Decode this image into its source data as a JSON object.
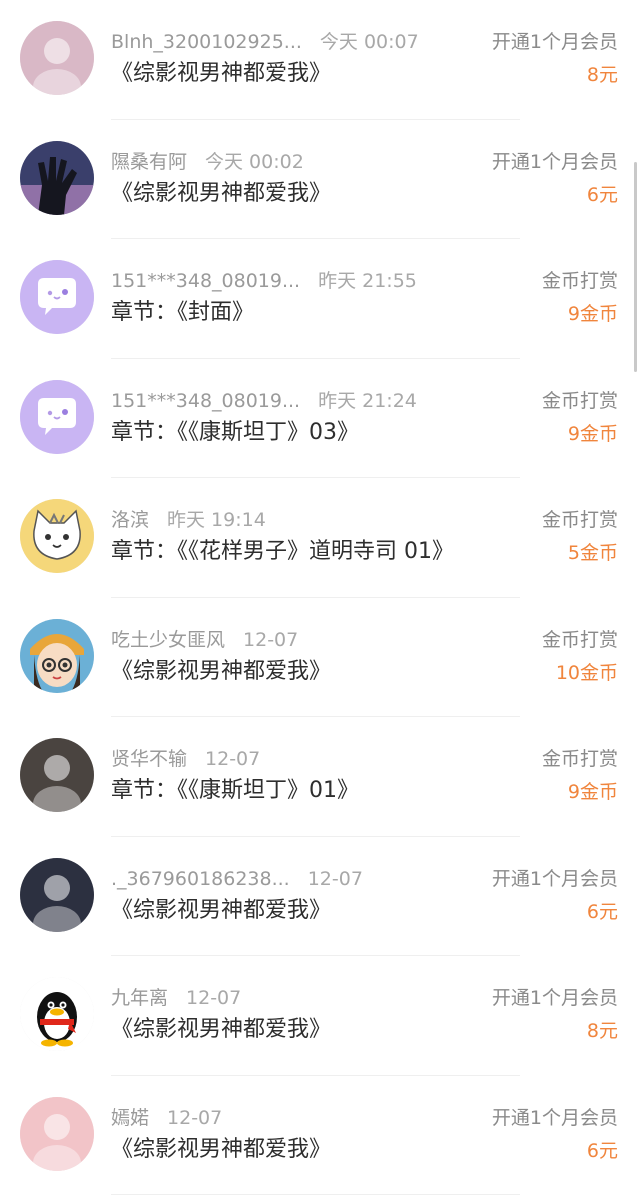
{
  "rows": [
    {
      "name": "Blnh_3200102925...",
      "time": "今天 00:07",
      "title": "《综影视男神都爱我》",
      "type": "开通1个月会员",
      "amount": "8元",
      "avatar": "photo-icon",
      "avatar_color": "#d9b8c6"
    },
    {
      "name": "隰桑有阿",
      "time": "今天 00:02",
      "title": "《综影视男神都爱我》",
      "type": "开通1个月会员",
      "amount": "6元",
      "avatar": "hand-silhouette-icon",
      "avatar_color": "#3a3f6b"
    },
    {
      "name": "151***348_08019...",
      "time": "昨天 21:55",
      "title": "章节：《封面》",
      "type": "金币打赏",
      "amount": "9金币",
      "avatar": "chat-bubble-icon",
      "avatar_color": "#c9b5f3"
    },
    {
      "name": "151***348_08019...",
      "time": "昨天 21:24",
      "title": "章节：《《康斯坦丁》03》",
      "type": "金币打赏",
      "amount": "9金币",
      "avatar": "chat-bubble-icon",
      "avatar_color": "#c9b5f3"
    },
    {
      "name": "洛滨",
      "time": "昨天 19:14",
      "title": "章节：《《花样男子》道明寺司 01》",
      "type": "金币打赏",
      "amount": "5金币",
      "avatar": "cat-icon",
      "avatar_color": "#f5d77a"
    },
    {
      "name": "吃土少女匪风",
      "time": "12-07",
      "title": "《综影视男神都爱我》",
      "type": "金币打赏",
      "amount": "10金币",
      "avatar": "cartoon-girl-icon",
      "avatar_color": "#e8a63a"
    },
    {
      "name": "贤华不输",
      "time": "12-07",
      "title": "章节：《《康斯坦丁》01》",
      "type": "金币打赏",
      "amount": "9金币",
      "avatar": "photo-icon",
      "avatar_color": "#4a4440"
    },
    {
      "name": "._367960186238...",
      "time": "12-07",
      "title": "《综影视男神都爱我》",
      "type": "开通1个月会员",
      "amount": "6元",
      "avatar": "photo-icon",
      "avatar_color": "#2c3040"
    },
    {
      "name": "九年离",
      "time": "12-07",
      "title": "《综影视男神都爱我》",
      "type": "开通1个月会员",
      "amount": "8元",
      "avatar": "penguin-icon",
      "avatar_color": "#ffffff"
    },
    {
      "name": "嫣婼",
      "time": "12-07",
      "title": "《综影视男神都爱我》",
      "type": "开通1个月会员",
      "amount": "6元",
      "avatar": "photo-icon",
      "avatar_color": "#f2c4c8"
    }
  ],
  "colors": {
    "amount": "#f0853d",
    "name": "#9a9a9a",
    "title": "#2e2e2e"
  }
}
